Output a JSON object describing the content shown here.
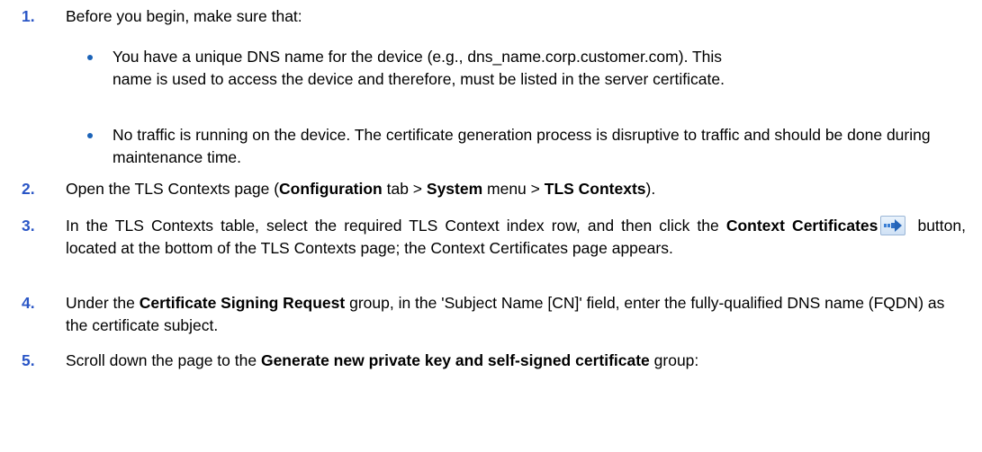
{
  "steps": [
    {
      "number": "1.",
      "text": "Before you begin, make sure that:"
    },
    {
      "number": "2.",
      "pre": "Open the TLS Contexts page (",
      "b1": "Configuration",
      "mid1": " tab > ",
      "b2": "System",
      "mid2": " menu > ",
      "b3": "TLS Contexts",
      "post": ")."
    },
    {
      "number": "3.",
      "pre": "In the TLS Contexts table, select the required TLS Context index row, and then click the ",
      "b1": "Context Certificates",
      "post": " button, located at the bottom of the TLS Contexts page; the Context Certificates page appears."
    },
    {
      "number": "4.",
      "pre": "Under the ",
      "b1": "Certificate Signing Request",
      "post": " group, in the 'Subject Name [CN]' field, enter the fully-qualified DNS name (FQDN) as the certificate subject."
    },
    {
      "number": "5.",
      "pre": "Scroll down the page to the ",
      "b1": "Generate new private key and self-signed certificate",
      "post": " group:"
    }
  ],
  "bullets": [
    "You have a unique DNS name for the device (e.g., dns_name.corp.customer.com). This name is used to access the device and therefore, must be listed in the server certificate.",
    "No traffic is running on the device. The certificate generation process is disruptive to traffic and should be done during maintenance time."
  ],
  "icons": {
    "context_certificates": "arrow-right-icon"
  },
  "colors": {
    "step_number": "#2a56c6",
    "bullet": "#1b63b8"
  }
}
